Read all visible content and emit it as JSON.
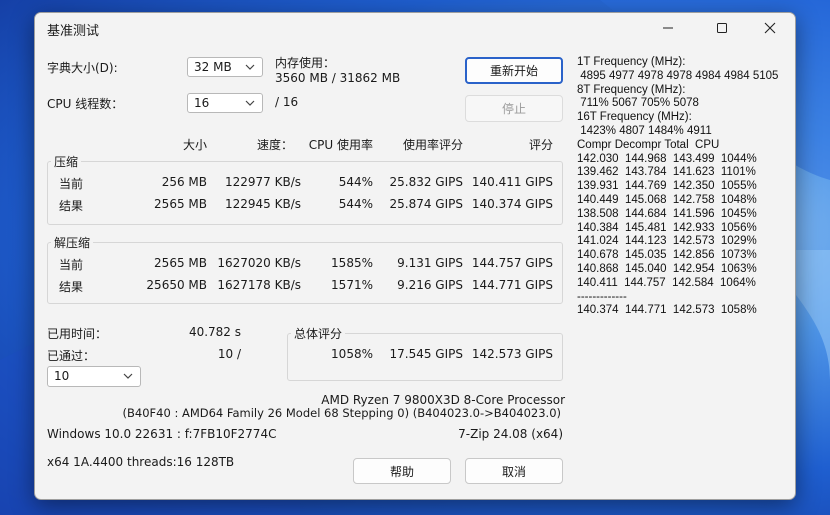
{
  "window": {
    "title": "基准测试"
  },
  "dict": {
    "label": "字典大小(D):",
    "value": "32 MB"
  },
  "memory": {
    "label": "内存使用：",
    "value": "3560 MB / 31862 MB"
  },
  "threads": {
    "label": "CPU 线程数：",
    "value": "16",
    "total": "/ 16"
  },
  "buttons": {
    "restart": "重新开始",
    "stop": "停止",
    "help": "帮助",
    "cancel": "取消"
  },
  "table": {
    "headers": [
      "大小",
      "速度：",
      "CPU 使用率",
      "使用率评分",
      "评分"
    ],
    "compress": {
      "title": "压缩",
      "rows": [
        [
          "当前",
          "256 MB",
          "122977 KB/s",
          "544%",
          "25.832 GIPS",
          "140.411 GIPS"
        ],
        [
          "结果",
          "2565 MB",
          "122945 KB/s",
          "544%",
          "25.874 GIPS",
          "140.374 GIPS"
        ]
      ]
    },
    "decompress": {
      "title": "解压缩",
      "rows": [
        [
          "当前",
          "2565 MB",
          "1627020 KB/s",
          "1585%",
          "9.131 GIPS",
          "144.757 GIPS"
        ],
        [
          "结果",
          "25650 MB",
          "1627178 KB/s",
          "1571%",
          "9.216 GIPS",
          "144.771 GIPS"
        ]
      ]
    }
  },
  "elapsed": {
    "label": "已用时间：",
    "value": "40.782 s"
  },
  "passed": {
    "label": "已通过：",
    "value": "10 /",
    "select": "10"
  },
  "total": {
    "title": "总体评分",
    "usage": "1058%",
    "usage_score": "17.545 GIPS",
    "score": "142.573 GIPS"
  },
  "cpu": {
    "name": "AMD Ryzen 7 9800X3D 8-Core Processor",
    "detail": "(B40F40 : AMD64 Family 26 Model 68 Stepping 0) (B404023.0->B404023.0)"
  },
  "os": "Windows 10.0 22631 : f:7FB10F2774C",
  "version": "7-Zip 24.08 (x64)",
  "arch": "x64 1A.4400 threads:16 128TB",
  "side_lines": [
    "1T Frequency (MHz):",
    " 4895 4977 4978 4978 4984 4984 5105",
    "8T Frequency (MHz):",
    " 711% 5067 705% 5078",
    "16T Frequency (MHz):",
    " 1423% 4807 1484% 4911",
    "Compr Decompr Total  CPU",
    "142.030  144.968  143.499  1044%",
    "139.462  143.784  141.623  1101%",
    "139.931  144.769  142.350  1055%",
    "140.449  145.068  142.758  1048%",
    "138.508  144.684  141.596  1045%",
    "140.384  145.481  142.933  1056%",
    "141.024  144.123  142.573  1029%",
    "140.678  145.035  142.856  1073%",
    "140.868  145.040  142.954  1063%",
    "140.411  144.757  142.584  1064%",
    "-------------",
    "140.374  144.771  142.573  1058%"
  ]
}
